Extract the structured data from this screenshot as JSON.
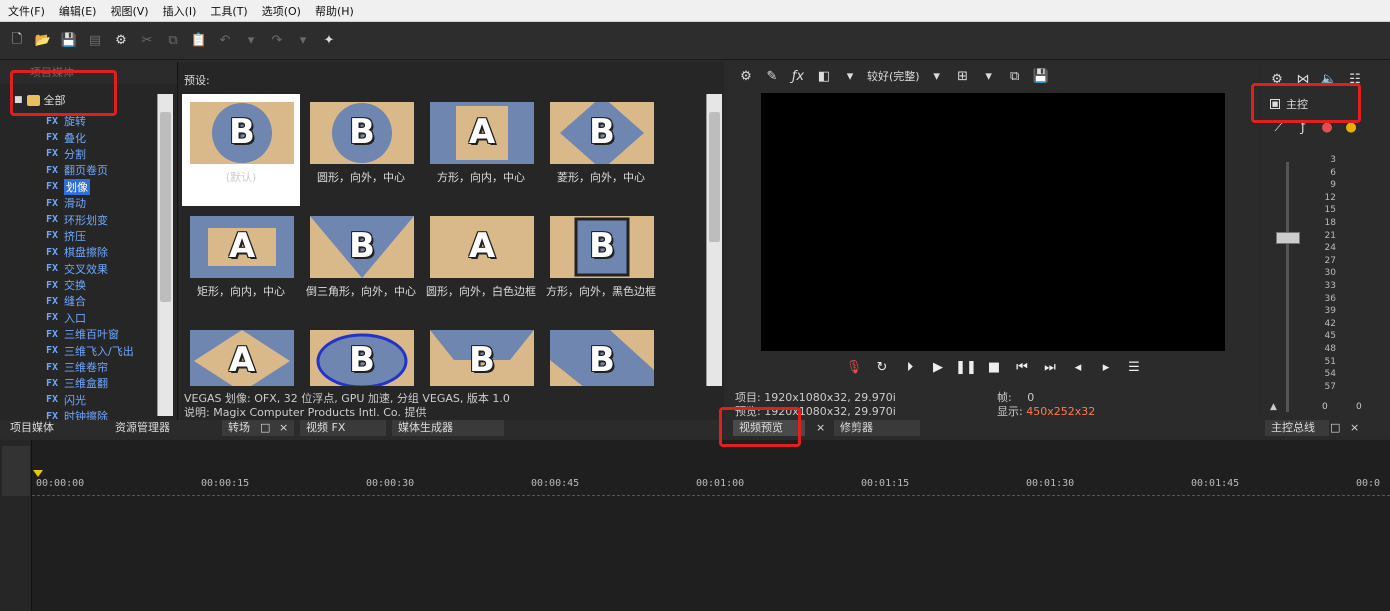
{
  "menu": [
    "文件(F)",
    "编辑(E)",
    "视图(V)",
    "插入(I)",
    "工具(T)",
    "选项(O)",
    "帮助(H)"
  ],
  "explorer": {
    "header": "项目媒体",
    "root_label": "全部",
    "fx_tag": "FX",
    "items": [
      "旋转",
      "叠化",
      "分割",
      "翻页卷页",
      "划像",
      "滑动",
      "环形划变",
      "挤压",
      "棋盘擦除",
      "交叉效果",
      "交换",
      "缝合",
      "入口",
      "三维百叶窗",
      "三维飞入/飞出",
      "三维卷帘",
      "三维盒翻",
      "闪光",
      "时钟擦除"
    ],
    "selected_index": 4
  },
  "presets": {
    "title": "预设:",
    "tiles": [
      {
        "letter": "B",
        "label": "(默认)",
        "shape": "circle"
      },
      {
        "letter": "B",
        "label": "圆形，向外，中心",
        "shape": "circle"
      },
      {
        "letter": "A",
        "label": "方形，向内，中心",
        "shape": "square-in"
      },
      {
        "letter": "B",
        "label": "菱形，向外，中心",
        "shape": "diamond"
      },
      {
        "letter": "A",
        "label": "矩形，向内，中心",
        "shape": "rect-in"
      },
      {
        "letter": "B",
        "label": "倒三角形，向外，中心",
        "shape": "triangle"
      },
      {
        "letter": "A",
        "label": "圆形，向外，白色边框",
        "shape": "plain"
      },
      {
        "letter": "B",
        "label": "方形，向外，黑色边框",
        "shape": "square-border"
      },
      {
        "letter": "A",
        "label": "",
        "shape": "diamond-in"
      },
      {
        "letter": "B",
        "label": "",
        "shape": "ellipse"
      },
      {
        "letter": "B",
        "label": "",
        "shape": "trapezoid"
      },
      {
        "letter": "B",
        "label": "",
        "shape": "diamond2"
      }
    ],
    "info1": "VEGAS 划像: OFX, 32 位浮点, GPU 加速, 分组 VEGAS, 版本 1.0",
    "info2": "说明: Magix Computer Products Intl. Co. 提供"
  },
  "preview": {
    "quality": "较好(完整)",
    "project_label": "项目:",
    "project_value": "1920x1080x32, 29.970i",
    "preview_label": "预览:",
    "preview_value": "1920x1080x32, 29.970i",
    "frame_label": "帧:",
    "frame_value": "0",
    "display_label": "显示:",
    "display_value": "450x252x32"
  },
  "master": {
    "title": "主控",
    "levels": [
      "3",
      "6",
      "9",
      "12",
      "15",
      "18",
      "21",
      "24",
      "27",
      "30",
      "33",
      "36",
      "39",
      "42",
      "45",
      "48",
      "51",
      "54",
      "57"
    ],
    "bottom_left": "0",
    "bottom_right": "0"
  },
  "dock": {
    "project_media": "项目媒体",
    "explorer": "资源管理器",
    "transitions": "转场",
    "video_fx": "视频 FX",
    "media_generators": "媒体生成器",
    "video_preview": "视频预览",
    "trimmer": "修剪器",
    "master_bus": "主控总线",
    "close": "×",
    "float": "□"
  },
  "timeline": {
    "ticks": [
      "00:00:00",
      "00:00:15",
      "00:00:30",
      "00:00:45",
      "00:01:00",
      "00:01:15",
      "00:01:30",
      "00:01:45",
      "00:0"
    ]
  }
}
